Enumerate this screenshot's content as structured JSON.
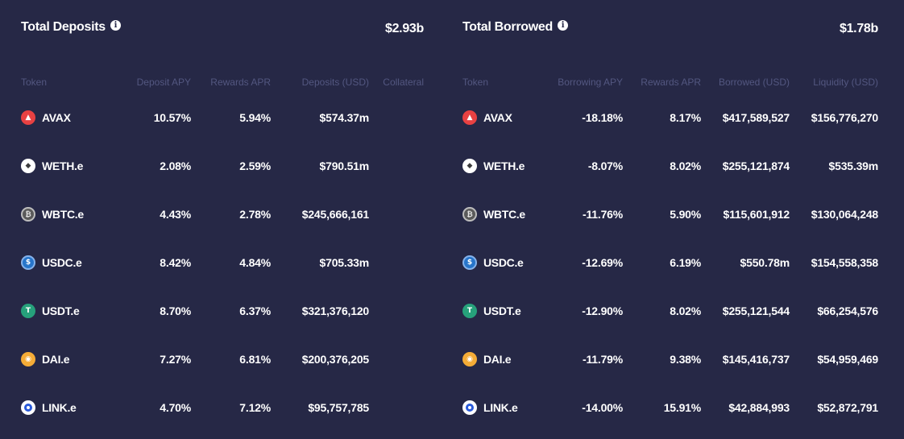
{
  "deposits": {
    "title": "Total Deposits",
    "total": "$2.93b",
    "columns": [
      "Token",
      "Deposit APY",
      "Rewards APR",
      "Deposits (USD)",
      "Collateral"
    ],
    "rows": [
      {
        "token": "AVAX",
        "icon": "avax-icon",
        "apy": "10.57%",
        "rewards": "5.94%",
        "amount": "$574.37m"
      },
      {
        "token": "WETH.e",
        "icon": "weth-icon",
        "apy": "2.08%",
        "rewards": "2.59%",
        "amount": "$790.51m"
      },
      {
        "token": "WBTC.e",
        "icon": "wbtc-icon",
        "apy": "4.43%",
        "rewards": "2.78%",
        "amount": "$245,666,161"
      },
      {
        "token": "USDC.e",
        "icon": "usdc-icon",
        "apy": "8.42%",
        "rewards": "4.84%",
        "amount": "$705.33m"
      },
      {
        "token": "USDT.e",
        "icon": "usdt-icon",
        "apy": "8.70%",
        "rewards": "6.37%",
        "amount": "$321,376,120"
      },
      {
        "token": "DAI.e",
        "icon": "dai-icon",
        "apy": "7.27%",
        "rewards": "6.81%",
        "amount": "$200,376,205"
      },
      {
        "token": "LINK.e",
        "icon": "link-icon",
        "apy": "4.70%",
        "rewards": "7.12%",
        "amount": "$95,757,785"
      }
    ]
  },
  "borrowed": {
    "title": "Total Borrowed",
    "total": "$1.78b",
    "columns": [
      "Token",
      "Borrowing APY",
      "Rewards APR",
      "Borrowed (USD)",
      "Liquidity (USD)"
    ],
    "rows": [
      {
        "token": "AVAX",
        "icon": "avax-icon",
        "apy": "-18.18%",
        "rewards": "8.17%",
        "amount": "$417,589,527",
        "liquidity": "$156,776,270"
      },
      {
        "token": "WETH.e",
        "icon": "weth-icon",
        "apy": "-8.07%",
        "rewards": "8.02%",
        "amount": "$255,121,874",
        "liquidity": "$535.39m"
      },
      {
        "token": "WBTC.e",
        "icon": "wbtc-icon",
        "apy": "-11.76%",
        "rewards": "5.90%",
        "amount": "$115,601,912",
        "liquidity": "$130,064,248"
      },
      {
        "token": "USDC.e",
        "icon": "usdc-icon",
        "apy": "-12.69%",
        "rewards": "6.19%",
        "amount": "$550.78m",
        "liquidity": "$154,558,358"
      },
      {
        "token": "USDT.e",
        "icon": "usdt-icon",
        "apy": "-12.90%",
        "rewards": "8.02%",
        "amount": "$255,121,544",
        "liquidity": "$66,254,576"
      },
      {
        "token": "DAI.e",
        "icon": "dai-icon",
        "apy": "-11.79%",
        "rewards": "9.38%",
        "amount": "$145,416,737",
        "liquidity": "$54,959,469"
      },
      {
        "token": "LINK.e",
        "icon": "link-icon",
        "apy": "-14.00%",
        "rewards": "15.91%",
        "amount": "$42,884,993",
        "liquidity": "$52,872,791"
      }
    ]
  },
  "colors": {
    "background": "#262846",
    "header_text": "#535780",
    "text": "#ffffff"
  }
}
